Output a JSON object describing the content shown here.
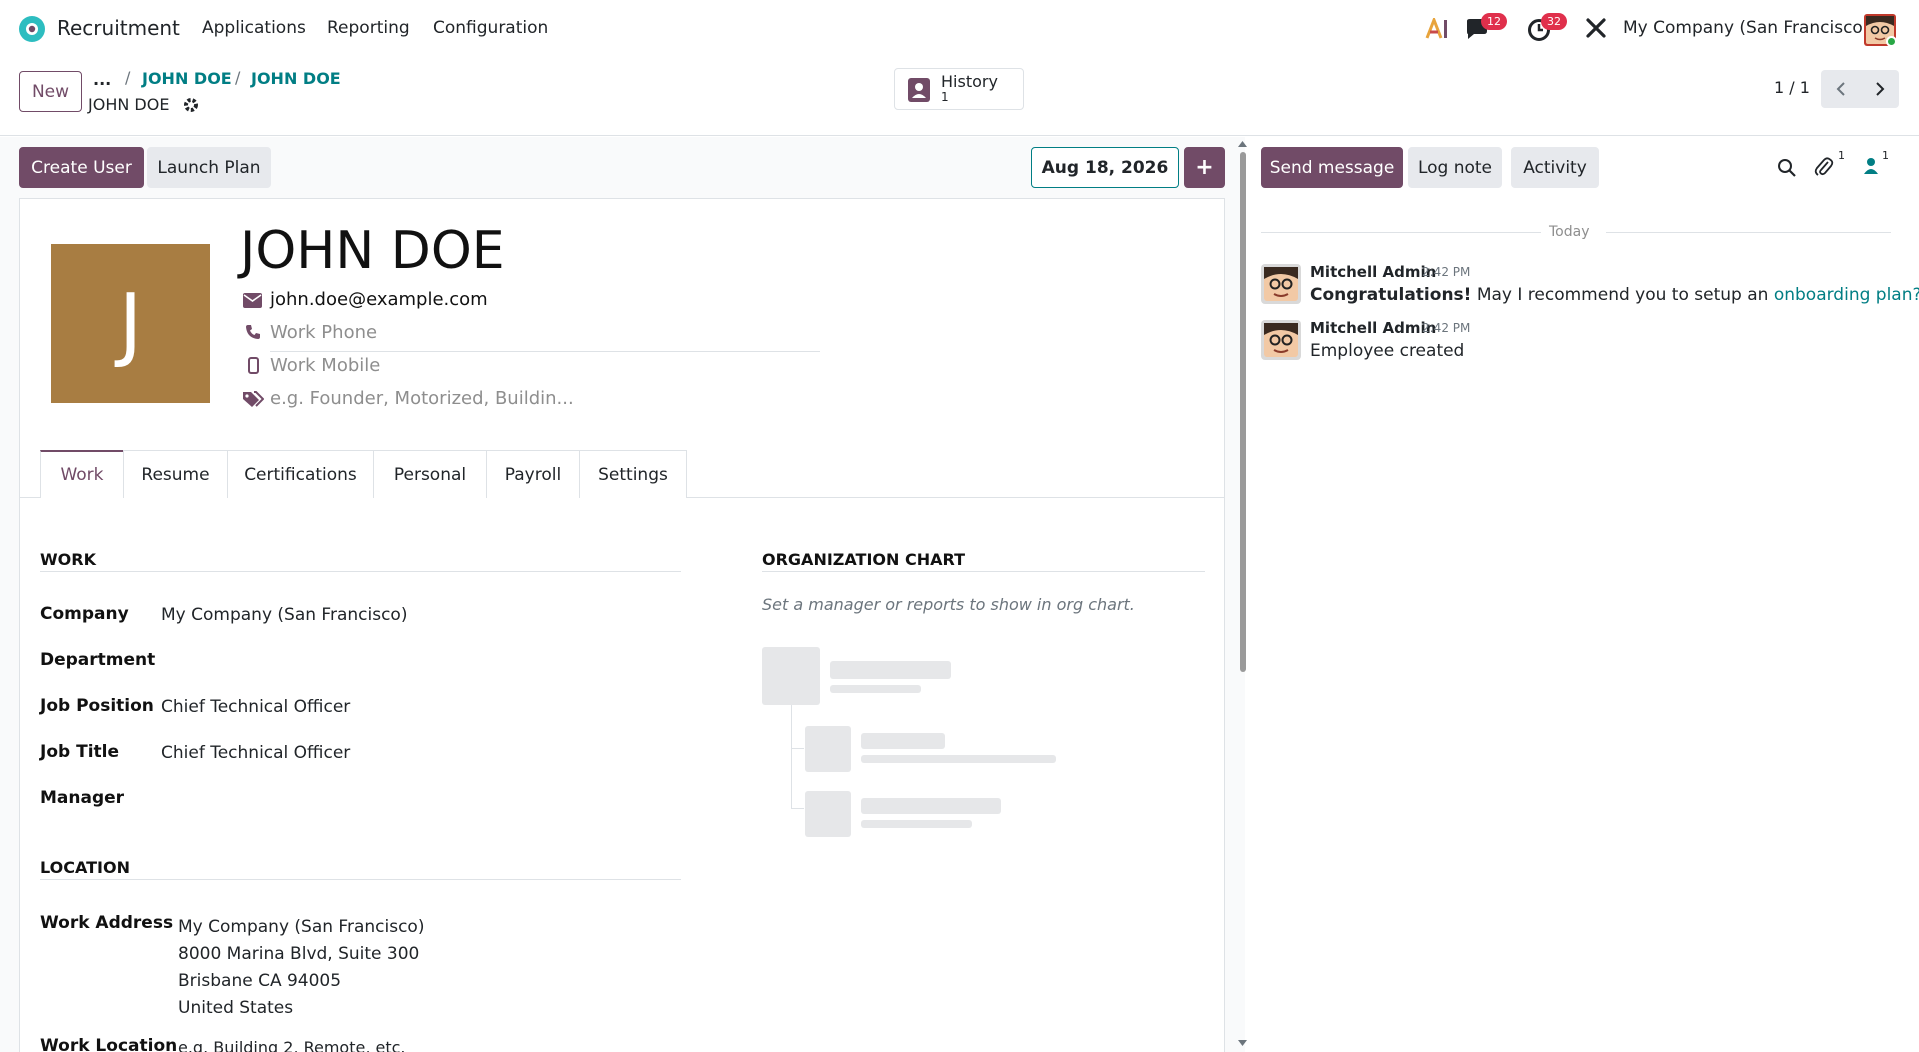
{
  "topbar": {
    "app_name": "Recruitment",
    "menu": [
      "Applications",
      "Reporting",
      "Configuration"
    ],
    "messages_count": "12",
    "activities_count": "32",
    "company": "My Company (San Francisco)"
  },
  "control": {
    "new_label": "New",
    "breadcrumb_ellipsis": "...",
    "breadcrumb": [
      "JOHN DOE",
      "JOHN DOE"
    ],
    "record_title": "JOHN DOE",
    "history_label": "History",
    "history_count": "1",
    "pager": "1 / 1"
  },
  "actions": {
    "create_user": "Create User",
    "launch_plan": "Launch Plan",
    "date": "Aug 18, 2026",
    "add_symbol": "+"
  },
  "employee": {
    "initial": "J",
    "name": "JOHN DOE",
    "email": "john.doe@example.com",
    "work_phone_placeholder": "Work Phone",
    "work_mobile_placeholder": "Work Mobile",
    "tags_placeholder": "e.g. Founder, Motorized, Buildin..."
  },
  "tabs": [
    "Work",
    "Resume",
    "Certifications",
    "Personal",
    "Payroll",
    "Settings"
  ],
  "work": {
    "section_title": "WORK",
    "company_label": "Company",
    "company_value": "My Company (San Francisco)",
    "department_label": "Department",
    "job_position_label": "Job Position",
    "job_position_value": "Chief Technical Officer",
    "job_title_label": "Job Title",
    "job_title_value": "Chief Technical Officer",
    "manager_label": "Manager"
  },
  "location": {
    "section_title": "LOCATION",
    "work_address_label": "Work Address",
    "address_lines": [
      "My Company (San Francisco)",
      "8000 Marina Blvd, Suite 300",
      "Brisbane CA 94005",
      "United States"
    ],
    "work_location_label": "Work Location",
    "work_location_placeholder": "e.g. Building 2, Remote, etc."
  },
  "org_chart": {
    "title": "ORGANIZATION CHART",
    "empty_hint": "Set a manager or reports to show in org chart."
  },
  "chatter": {
    "send_message": "Send message",
    "log_note": "Log note",
    "activity": "Activity",
    "attachments_count": "1",
    "followers_count": "1",
    "date_separator": "Today",
    "messages": [
      {
        "author": "Mitchell Admin",
        "time": "2:42 PM",
        "bold": "Congratulations!",
        "text": " May I recommend you to setup an ",
        "link": "onboarding plan?"
      },
      {
        "author": "Mitchell Admin",
        "time": "2:42 PM",
        "bold": "",
        "text": "Employee created",
        "link": ""
      }
    ]
  },
  "colors": {
    "primary": "#714b67",
    "link": "#017e84",
    "badge": "#e0304c",
    "avatar_bg": "#a87d42"
  }
}
